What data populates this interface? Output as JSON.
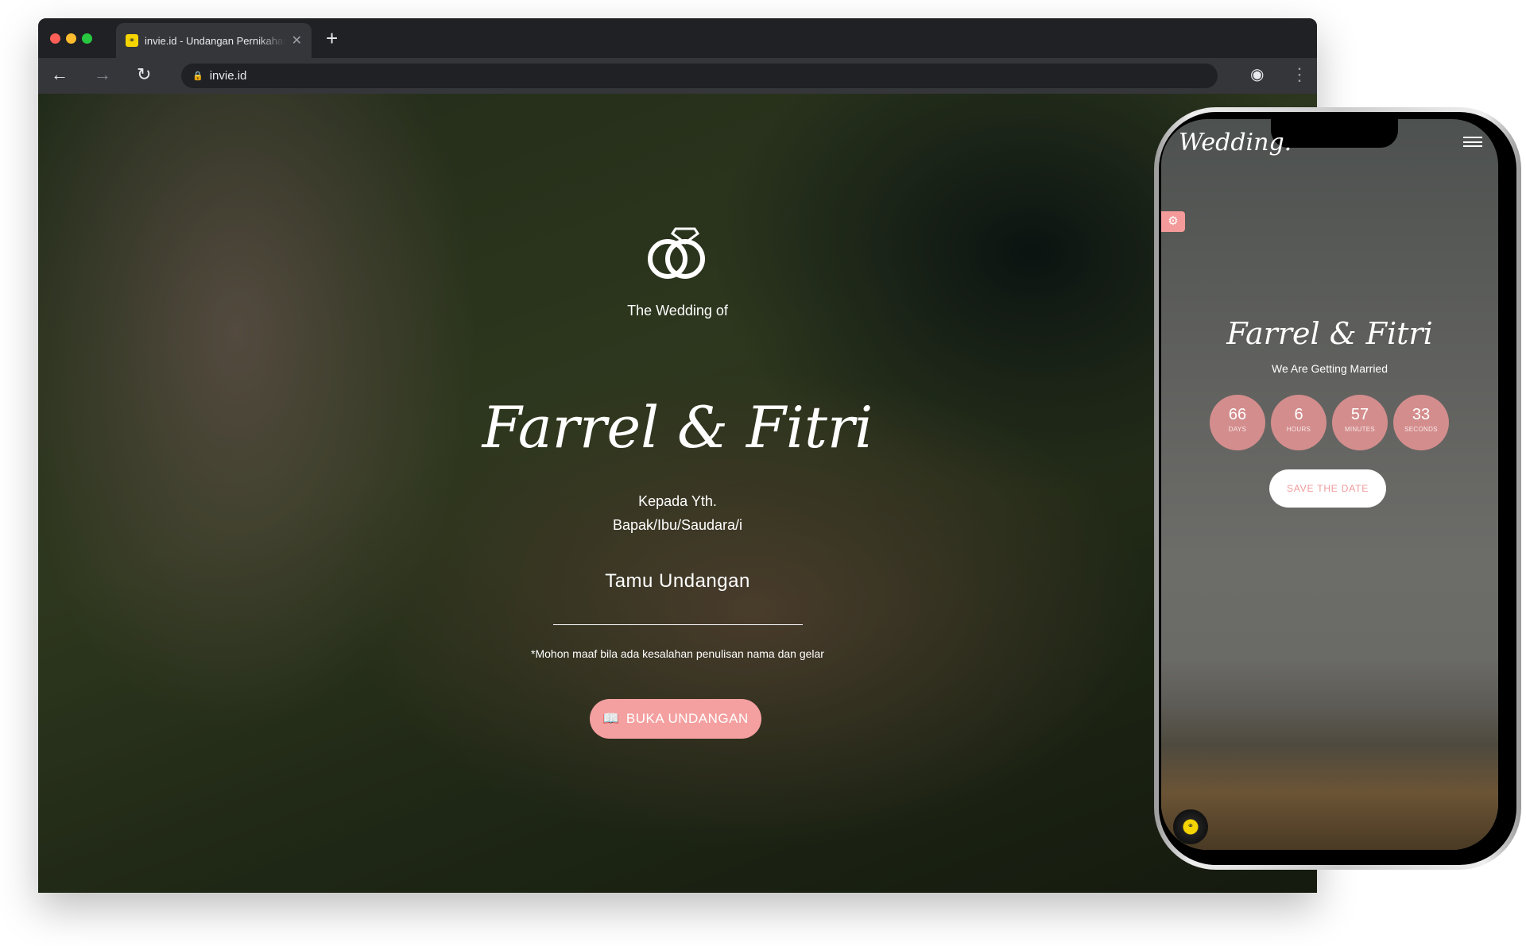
{
  "browser": {
    "tab_title": "invie.id - Undangan Pernikahan",
    "url": "invie.id",
    "favicon": "rings-icon"
  },
  "desktop": {
    "subtitle": "The Wedding of",
    "names": "Farrel & Fitri",
    "greeting_line1": "Kepada Yth.",
    "greeting_line2": "Bapak/Ibu/Saudara/i",
    "guest_name": "Tamu Undangan",
    "note": "*Mohon maaf bila ada kesalahan penulisan nama dan gelar",
    "open_button": "BUKA UNDANGAN",
    "accent": "#f4a0a0"
  },
  "mobile": {
    "logo": "Wedding.",
    "names": "Farrel & Fitri",
    "tagline": "We Are Getting Married",
    "countdown": [
      {
        "value": "66",
        "label": "DAYS"
      },
      {
        "value": "6",
        "label": "HOURS"
      },
      {
        "value": "57",
        "label": "MINUTES"
      },
      {
        "value": "33",
        "label": "SECONDS"
      }
    ],
    "save_button": "SAVE THE DATE",
    "accent": "#d48d8d"
  }
}
